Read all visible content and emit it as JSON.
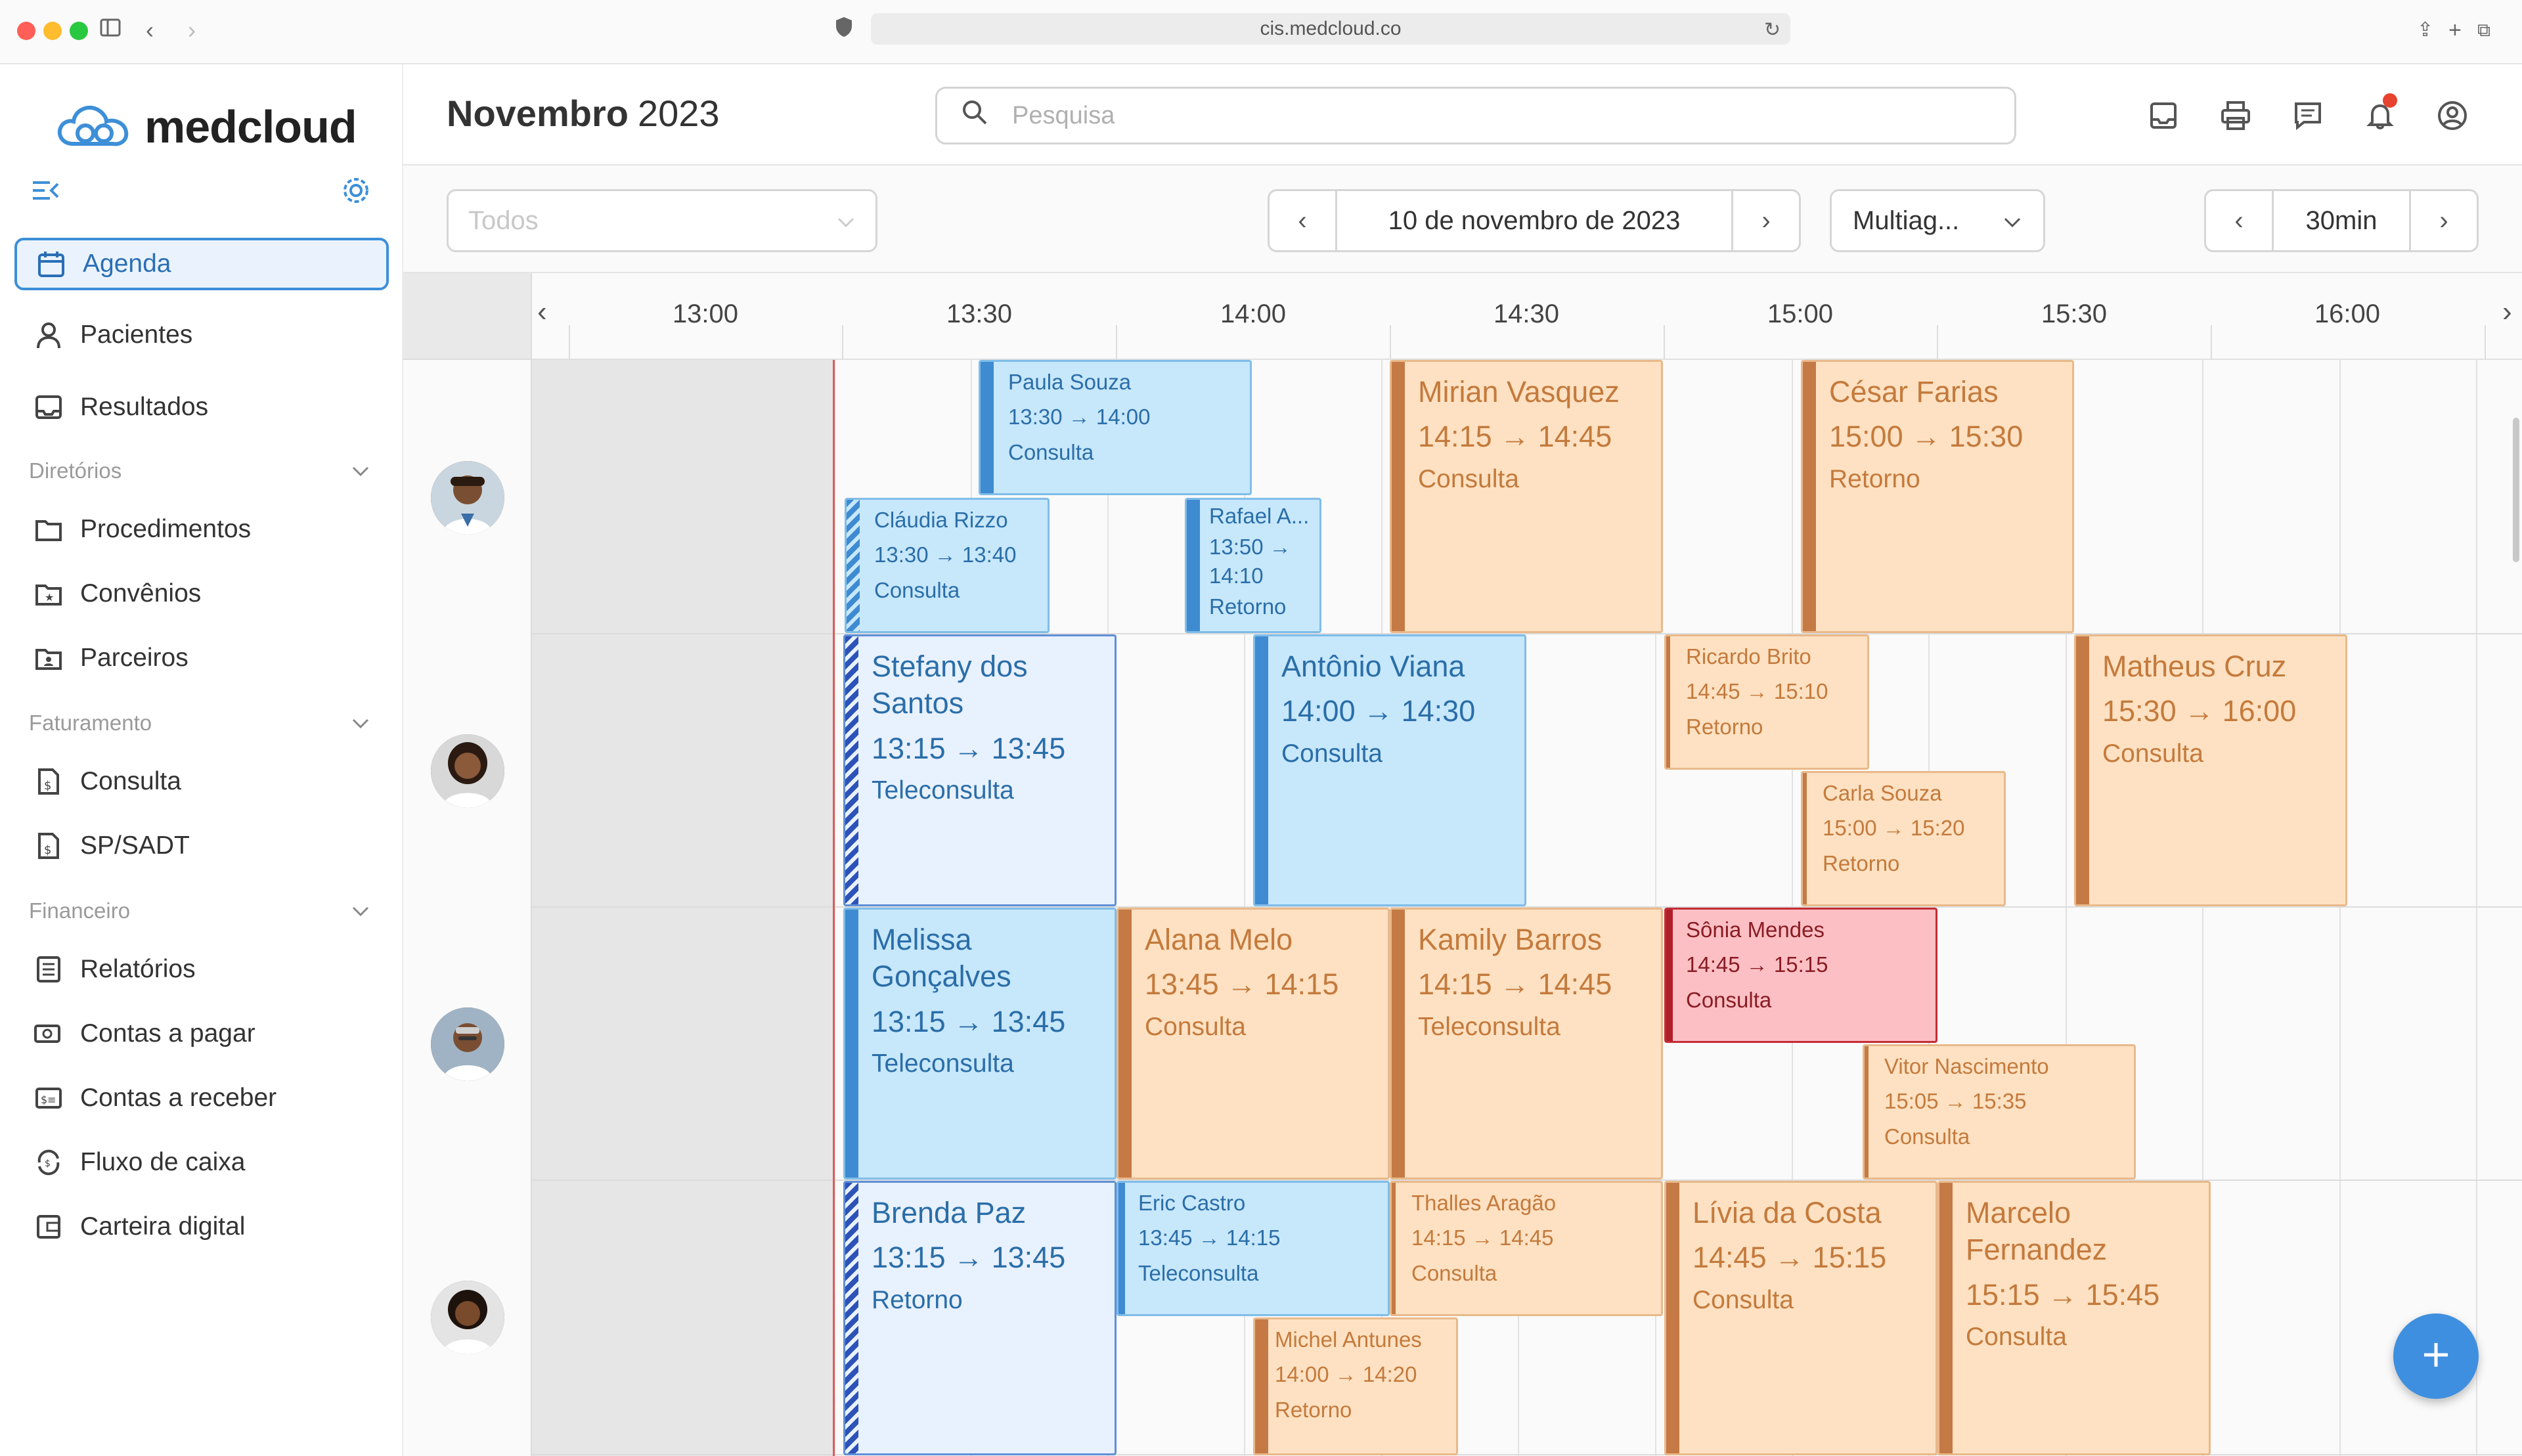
{
  "browser": {
    "url": "cis.medcloud.co"
  },
  "app": {
    "logo_text": "medcloud"
  },
  "sidebar": {
    "agenda": "Agenda",
    "pacientes": "Pacientes",
    "resultados": "Resultados",
    "sections": {
      "diretorios": "Diretórios",
      "faturamento": "Faturamento",
      "financeiro": "Financeiro"
    },
    "procedimentos": "Procedimentos",
    "convenios": "Convênios",
    "parceiros": "Parceiros",
    "consulta": "Consulta",
    "spsadt": "SP/SADT",
    "relatorios": "Relatórios",
    "contas_pagar": "Contas a pagar",
    "contas_receber": "Contas a receber",
    "fluxo_caixa": "Fluxo de caixa",
    "carteira": "Carteira digital"
  },
  "header": {
    "month": "Novembro",
    "year": "2023",
    "search_placeholder": "Pesquisa"
  },
  "filters": {
    "professional_placeholder": "Todos",
    "date": "10 de novembro de 2023",
    "view": "Multiag...",
    "interval": "30min"
  },
  "timeline": {
    "labels": [
      "13:00",
      "13:30",
      "14:00",
      "14:30",
      "15:00",
      "15:30",
      "16:00"
    ]
  },
  "appointments": [
    {
      "name": "Paula Souza",
      "time": "13:30 → 14:00",
      "type": "Consulta"
    },
    {
      "name": "Cláudia Rizzo",
      "time": "13:30 → 13:40",
      "type": "Consulta"
    },
    {
      "name": "Rafael A...",
      "time": "13:50 →",
      "time2": "14:10",
      "type": "Retorno"
    },
    {
      "name": "Mirian Vasquez",
      "time": "14:15 → 14:45",
      "type": "Consulta"
    },
    {
      "name": "César Farias",
      "time": "15:00 → 15:30",
      "type": "Retorno"
    },
    {
      "name": "Stefany dos",
      "name2": "Santos",
      "time": "13:15 → 13:45",
      "type": "Teleconsulta"
    },
    {
      "name": "Antônio Viana",
      "time": "14:00 → 14:30",
      "type": "Consulta"
    },
    {
      "name": "Ricardo Brito",
      "time": "14:45 → 15:10",
      "type": "Retorno"
    },
    {
      "name": "Matheus Cruz",
      "time": "15:30 → 16:00",
      "type": "Consulta"
    },
    {
      "name": "Carla Souza",
      "time": "15:00 → 15:20",
      "type": "Retorno"
    },
    {
      "name": "Melissa",
      "name2": "Gonçalves",
      "time": "13:15 → 13:45",
      "type": "Teleconsulta"
    },
    {
      "name": "Alana Melo",
      "time": "13:45 → 14:15",
      "type": "Consulta"
    },
    {
      "name": "Kamily Barros",
      "time": "14:15 → 14:45",
      "type": "Teleconsulta"
    },
    {
      "name": "Sônia Mendes",
      "time": "14:45 → 15:15",
      "type": "Consulta"
    },
    {
      "name": "Vitor Nascimento",
      "time": "15:05 → 15:35",
      "type": "Consulta"
    },
    {
      "name": "Brenda Paz",
      "time": "13:15 → 13:45",
      "type": "Retorno"
    },
    {
      "name": "Eric Castro",
      "time": "13:45 → 14:15",
      "type": "Teleconsulta"
    },
    {
      "name": "Thalles Aragão",
      "time": "14:15 → 14:45",
      "type": "Consulta"
    },
    {
      "name": "Lívia da Costa",
      "time": "14:45 → 15:15",
      "type": "Consulta"
    },
    {
      "name": "Marcelo",
      "name2": "Fernandez",
      "time": "15:15 → 15:45",
      "type": "Consulta"
    },
    {
      "name": "Michel Antunes",
      "time": "14:00 → 14:20",
      "type": "Retorno"
    }
  ],
  "colors": {
    "accent": "#3d8fd8",
    "consulta_blue": "#c7e7fb",
    "retorno_orange": "#fde1c2",
    "alert_red": "#fcc0c4",
    "notification": "#e8432e"
  },
  "icons": [
    "sidebar-toggle-icon",
    "back-icon",
    "forward-icon",
    "shield-icon",
    "reload-icon",
    "share-icon",
    "new-tab-icon",
    "tabs-icon",
    "menu-collapse-icon",
    "settings-icon",
    "inbox-icon",
    "printer-icon",
    "chat-icon",
    "bell-icon",
    "user-icon",
    "search-icon",
    "plus-icon"
  ]
}
